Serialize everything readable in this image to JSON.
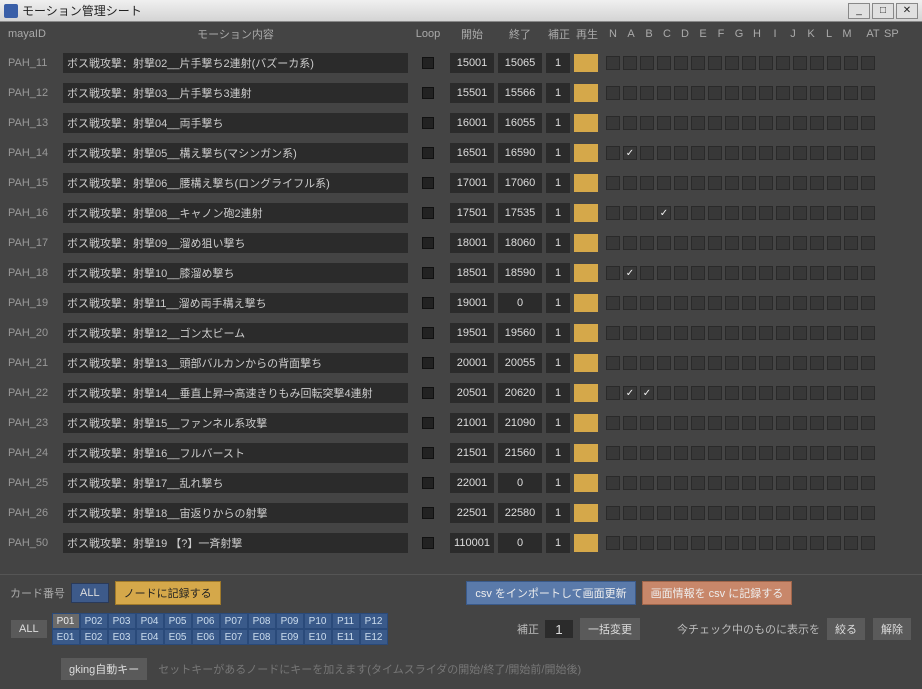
{
  "window": {
    "title": "モーション管理シート"
  },
  "header": {
    "id": "mayaID",
    "content": "モーション内容",
    "loop": "Loop",
    "start": "開始",
    "end": "終了",
    "hosei": "補正",
    "play": "再生",
    "checks": [
      "N",
      "A",
      "B",
      "C",
      "D",
      "E",
      "F",
      "G",
      "H",
      "I",
      "J",
      "K",
      "L",
      "M"
    ],
    "at": "AT",
    "sp": "SP"
  },
  "rows": [
    {
      "id": "PAH_11",
      "content": "ボス戦攻撃：射撃02__片手撃ち2連射(バズーカ系)",
      "start": "15001",
      "end": "15065",
      "hos": "1",
      "checks": []
    },
    {
      "id": "PAH_12",
      "content": "ボス戦攻撃：射撃03__片手撃ち3連射",
      "start": "15501",
      "end": "15566",
      "hos": "1",
      "checks": []
    },
    {
      "id": "PAH_13",
      "content": "ボス戦攻撃：射撃04__両手撃ち",
      "start": "16001",
      "end": "16055",
      "hos": "1",
      "checks": []
    },
    {
      "id": "PAH_14",
      "content": "ボス戦攻撃：射撃05__構え撃ち(マシンガン系)",
      "start": "16501",
      "end": "16590",
      "hos": "1",
      "checks": [
        1
      ]
    },
    {
      "id": "PAH_15",
      "content": "ボス戦攻撃：射撃06__腰構え撃ち(ロングライフル系)",
      "start": "17001",
      "end": "17060",
      "hos": "1",
      "checks": []
    },
    {
      "id": "PAH_16",
      "content": "ボス戦攻撃：射撃08__キャノン砲2連射",
      "start": "17501",
      "end": "17535",
      "hos": "1",
      "checks": [
        3
      ]
    },
    {
      "id": "PAH_17",
      "content": "ボス戦攻撃：射撃09__溜め狙い撃ち",
      "start": "18001",
      "end": "18060",
      "hos": "1",
      "checks": []
    },
    {
      "id": "PAH_18",
      "content": "ボス戦攻撃：射撃10__膝溜め撃ち",
      "start": "18501",
      "end": "18590",
      "hos": "1",
      "checks": [
        1
      ]
    },
    {
      "id": "PAH_19",
      "content": "ボス戦攻撃：射撃11__溜め両手構え撃ち",
      "start": "19001",
      "end": "0",
      "hos": "1",
      "checks": []
    },
    {
      "id": "PAH_20",
      "content": "ボス戦攻撃：射撃12__ゴン太ビーム",
      "start": "19501",
      "end": "19560",
      "hos": "1",
      "checks": []
    },
    {
      "id": "PAH_21",
      "content": "ボス戦攻撃：射撃13__頭部バルカンからの背面撃ち",
      "start": "20001",
      "end": "20055",
      "hos": "1",
      "checks": []
    },
    {
      "id": "PAH_22",
      "content": "ボス戦攻撃：射撃14__垂直上昇⇒高速きりもみ回転突撃4連射",
      "start": "20501",
      "end": "20620",
      "hos": "1",
      "checks": [
        1,
        2
      ]
    },
    {
      "id": "PAH_23",
      "content": "ボス戦攻撃：射撃15__ファンネル系攻撃",
      "start": "21001",
      "end": "21090",
      "hos": "1",
      "checks": []
    },
    {
      "id": "PAH_24",
      "content": "ボス戦攻撃：射撃16__フルバースト",
      "start": "21501",
      "end": "21560",
      "hos": "1",
      "checks": []
    },
    {
      "id": "PAH_25",
      "content": "ボス戦攻撃：射撃17__乱れ撃ち",
      "start": "22001",
      "end": "0",
      "hos": "1",
      "checks": []
    },
    {
      "id": "PAH_26",
      "content": "ボス戦攻撃：射撃18__宙返りからの射撃",
      "start": "22501",
      "end": "22580",
      "hos": "1",
      "checks": []
    },
    {
      "id": "PAH_50",
      "content": "ボス戦攻撃：射撃19 【?】一斉射撃",
      "start": "110001",
      "end": "0",
      "hos": "1",
      "checks": []
    }
  ],
  "bottom": {
    "card_label": "カード番号",
    "all": "ALL",
    "record_node": "ノードに記録する",
    "csv_import": "csv をインポートして画面更新",
    "csv_export": "画面情報を csv に記録する",
    "pages_p": [
      "P01",
      "P02",
      "P03",
      "P04",
      "P05",
      "P06",
      "P07",
      "P08",
      "P09",
      "P10",
      "P11",
      "P12"
    ],
    "pages_e": [
      "E01",
      "E02",
      "E03",
      "E04",
      "E05",
      "E06",
      "E07",
      "E08",
      "E09",
      "E10",
      "E11",
      "E12"
    ],
    "hosei": "補正",
    "hosei_val": "1",
    "batch": "一括変更",
    "check_label": "今チェック中のものに表示を",
    "filter": "絞る",
    "clear": "解除",
    "gking": "gking自動キー",
    "hint": "セットキーがあるノードにキーを加えます(タイムスライダの開始/終了/開始前/開始後)"
  }
}
